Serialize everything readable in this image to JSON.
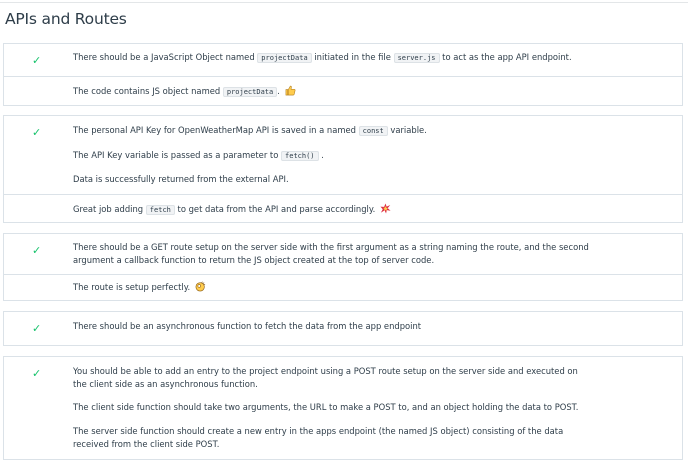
{
  "section": {
    "title": "APIs and Routes"
  },
  "criteria": [
    {
      "status_icon": "checkmark-icon",
      "req1": {
        "pre": "There should be a JavaScript Object named ",
        "code1": "projectData",
        "mid": " initiated in the file ",
        "code2": "server.js",
        "post": " to act as the app API endpoint."
      },
      "comment": {
        "pre": "The code contains JS object named ",
        "code": "projectData",
        "post": ". ",
        "emoji": "thumbs-up-icon"
      }
    },
    {
      "status_icon": "checkmark-icon",
      "req1": {
        "pre": "The personal API Key for OpenWeatherMap API is saved in a named ",
        "code": "const",
        "post": " variable."
      },
      "req2": {
        "pre": "The API Key variable is passed as a parameter to ",
        "code": "fetch()",
        "post": " ."
      },
      "req3": "Data is successfully returned from the external API.",
      "comment": {
        "pre": "Great job adding ",
        "code": "fetch",
        "post": " to get data from the API and parse accordingly. ",
        "emoji": "collision-icon"
      }
    },
    {
      "status_icon": "checkmark-icon",
      "req1a": "There should be a GET route setup on the server side with the first argument as a string naming the route, and the second",
      "req1b": "argument a callback function to return the JS object created at the top of server code.",
      "comment": {
        "text": "The route is setup perfectly. ",
        "emoji": "ok-hand-icon"
      }
    },
    {
      "status_icon": "checkmark-icon",
      "req1": "There should be an asynchronous function to fetch the data from the app endpoint"
    },
    {
      "status_icon": "checkmark-icon",
      "req1a": "You should be able to add an entry to the project endpoint using a POST route setup on the server side and executed on",
      "req1b": "the client side as an asynchronous function.",
      "req2": "The client side function should take two arguments, the URL to make a POST to, and an object holding the data to POST.",
      "req3a": "The server side function should create a new entry in the apps endpoint (the named JS object) consisting of the data",
      "req3b": "received from the client side POST."
    }
  ]
}
